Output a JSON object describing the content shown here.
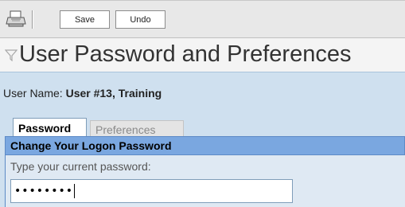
{
  "toolbar": {
    "print_icon": "printer-icon",
    "save_label": "Save",
    "undo_label": "Undo"
  },
  "header": {
    "filter_icon": "filter-icon",
    "title": "User Password and Preferences"
  },
  "user": {
    "label": "User Name:",
    "name": "User #13, Training"
  },
  "tabs": [
    {
      "label": "Password",
      "active": true
    },
    {
      "label": "Preferences",
      "active": false
    }
  ],
  "section": {
    "title": "Change Your Logon Password",
    "current_password_label": "Type your current password:",
    "current_password_value": "••••••••"
  },
  "colors": {
    "content_bg": "#cfe0ef",
    "section_header": "#7aa7e0"
  }
}
